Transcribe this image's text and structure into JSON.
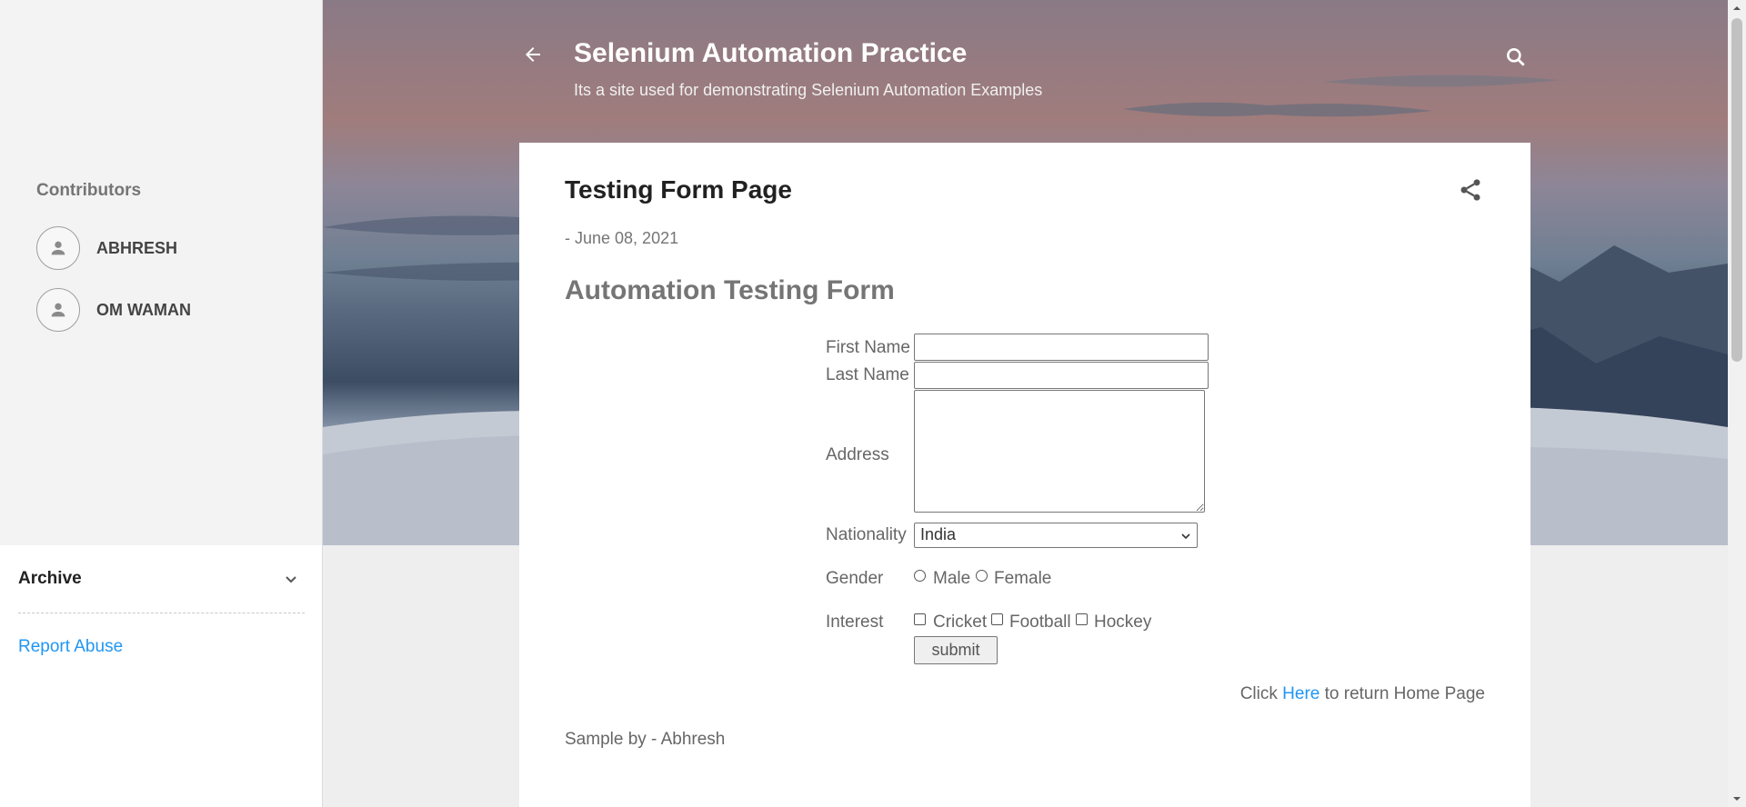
{
  "header": {
    "title": "Selenium Automation Practice",
    "description": "Its a site used for demonstrating Selenium Automation Examples"
  },
  "sidebar": {
    "contributors_title": "Contributors",
    "contributors": [
      {
        "name": "ABHRESH"
      },
      {
        "name": "OM WAMAN"
      }
    ],
    "archive_title": "Archive",
    "report_abuse": "Report Abuse"
  },
  "post": {
    "title": "Testing Form Page",
    "date": "- June 08, 2021",
    "form_heading": "Automation Testing Form",
    "labels": {
      "first_name": "First Name",
      "last_name": "Last Name",
      "address": "Address",
      "nationality": "Nationality",
      "gender": "Gender",
      "interest": "Interest"
    },
    "fields": {
      "first_name_value": "",
      "last_name_value": "",
      "address_value": "",
      "nationality_selected": "India"
    },
    "gender_options": [
      "Male",
      "Female"
    ],
    "interest_options": [
      "Cricket",
      "Football",
      "Hockey"
    ],
    "submit_label": "submit",
    "return_prefix": "Click",
    "return_link": "Here",
    "return_suffix": "to return Home Page",
    "sample_by": "Sample by - Abhresh"
  },
  "colors": {
    "link": "#2196f3",
    "sidebar_bg": "#f3f3f3",
    "page_bg": "#eeeeee"
  }
}
